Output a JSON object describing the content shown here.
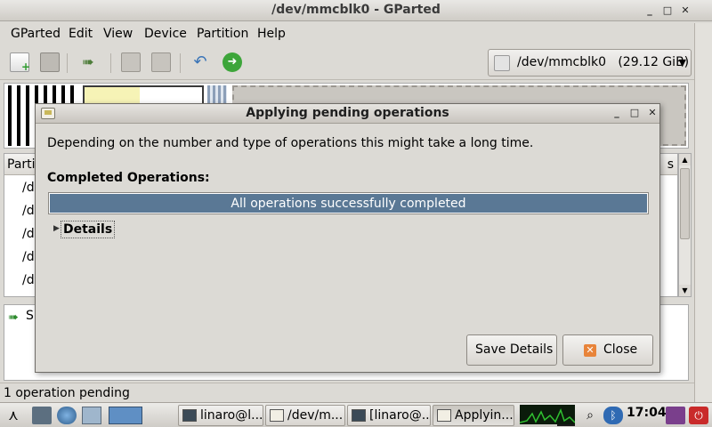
{
  "window": {
    "title": "/dev/mmcblk0 - GParted"
  },
  "menu": [
    "GParted",
    "Edit",
    "View",
    "Device",
    "Partition",
    "Help"
  ],
  "toolbar": {
    "buttons": [
      "new-icon",
      "delete-icon",
      "apply-icon",
      "copy-icon",
      "paste-icon",
      "undo-icon",
      "apply-all-icon"
    ],
    "device_label": "/dev/mmcblk0   (29.12 GiB)"
  },
  "partition_list": {
    "header_left": "Partiti",
    "header_right": "s",
    "rows": [
      "/de",
      "/de",
      "/de",
      "/de",
      "/de"
    ]
  },
  "pending_pane": {
    "text": "Sh"
  },
  "status": {
    "text": "1 operation pending"
  },
  "dialog": {
    "title": "Applying pending operations",
    "message": "Depending on the number and type of operations this might take a long time.",
    "completed_label": "Completed Operations:",
    "progress_text": "All operations successfully completed",
    "progress_fraction": 1.0,
    "details_label": "Details",
    "save_button": "Save Details",
    "close_button": "Close"
  },
  "taskbar": {
    "quick_icons": [
      "start-menu-icon",
      "file-manager-icon",
      "browser-icon",
      "desktop-icon",
      "workspace-icon"
    ],
    "tasks": [
      "linaro@l...",
      "/dev/m...",
      "[linaro@...",
      "Applyin..."
    ],
    "clock": "17:04"
  },
  "colors": {
    "progress_fill": "#5a7895",
    "close_icon": "#e8843a"
  }
}
